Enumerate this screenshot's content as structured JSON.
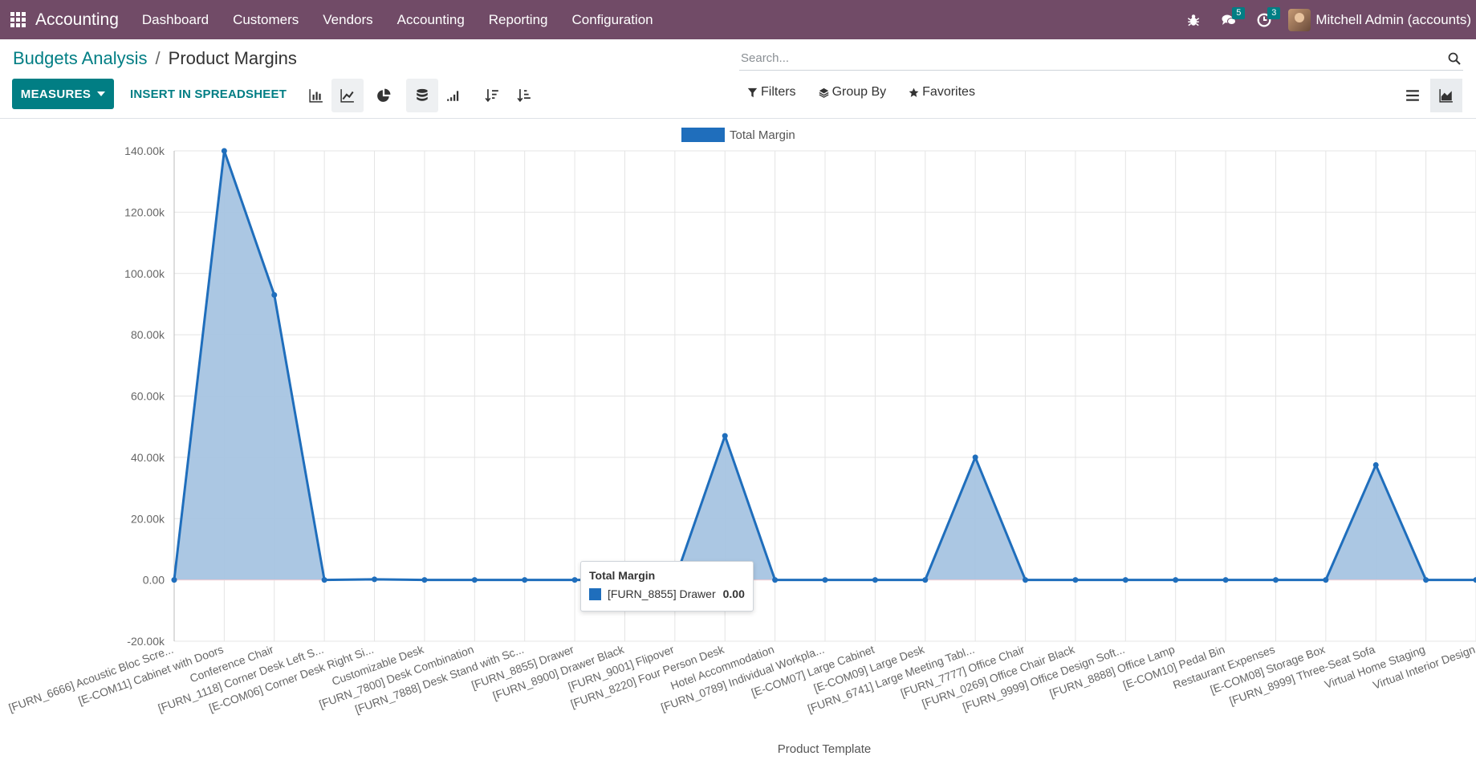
{
  "navbar": {
    "app_name": "Accounting",
    "menu": [
      "Dashboard",
      "Customers",
      "Vendors",
      "Accounting",
      "Reporting",
      "Configuration"
    ],
    "messages_count": "5",
    "activities_count": "3",
    "user_name": "Mitchell Admin (accounts)"
  },
  "breadcrumb": {
    "parent": "Budgets Analysis",
    "separator": "/",
    "current": "Product Margins"
  },
  "search": {
    "placeholder": "Search..."
  },
  "toolbar": {
    "measures_label": "MEASURES",
    "insert_label": "INSERT IN SPREADSHEET",
    "filters_label": "Filters",
    "group_by_label": "Group By",
    "favorites_label": "Favorites"
  },
  "colors": {
    "navbar": "#714b67",
    "primary": "#017e84",
    "series_line": "#1f6ebc",
    "series_fill": "#a7c4e2"
  },
  "tooltip": {
    "title": "Total Margin",
    "label": "[FURN_8855] Drawer",
    "value": "0.00"
  },
  "chart_data": {
    "type": "area",
    "xlabel": "Product Template",
    "ylabel": "",
    "ylim": [
      -20000,
      140000
    ],
    "yticks": [
      -20000,
      0,
      20000,
      40000,
      60000,
      80000,
      100000,
      120000,
      140000
    ],
    "ytick_labels": [
      "-20.00k",
      "0.00",
      "20.00k",
      "40.00k",
      "60.00k",
      "80.00k",
      "100.00k",
      "120.00k",
      "140.00k"
    ],
    "grid": true,
    "legend": "top-center",
    "categories": [
      "[FURN_6666] Acoustic Bloc Scre...",
      "[E-COM11] Cabinet with Doors",
      "Conference Chair",
      "[FURN_1118] Corner Desk Left S...",
      "[E-COM06] Corner Desk Right Si...",
      "Customizable Desk",
      "[FURN_7800] Desk Combination",
      "[FURN_7888] Desk Stand with Sc...",
      "[FURN_8855] Drawer",
      "[FURN_8900] Drawer Black",
      "[FURN_9001] Flipover",
      "[FURN_8220] Four Person Desk",
      "Hotel Accommodation",
      "[FURN_0789] Individual Workpla...",
      "[E-COM07] Large Cabinet",
      "[E-COM09] Large Desk",
      "[FURN_6741] Large Meeting Tabl...",
      "[FURN_7777] Office Chair",
      "[FURN_0269] Office Chair Black",
      "[FURN_9999] Office Design Soft...",
      "[FURN_8888] Office Lamp",
      "[E-COM10] Pedal Bin",
      "Restaurant Expenses",
      "[E-COM08] Storage Box",
      "[FURN_8999] Three-Seat Sofa",
      "Virtual Home Staging",
      "Virtual Interior Design"
    ],
    "series": [
      {
        "name": "Total Margin",
        "values": [
          0,
          140000,
          93000,
          0,
          200,
          0,
          0,
          0,
          0,
          0,
          0,
          47000,
          0,
          0,
          0,
          0,
          40000,
          0,
          0,
          0,
          0,
          0,
          0,
          0,
          37500,
          0,
          0
        ]
      }
    ]
  }
}
